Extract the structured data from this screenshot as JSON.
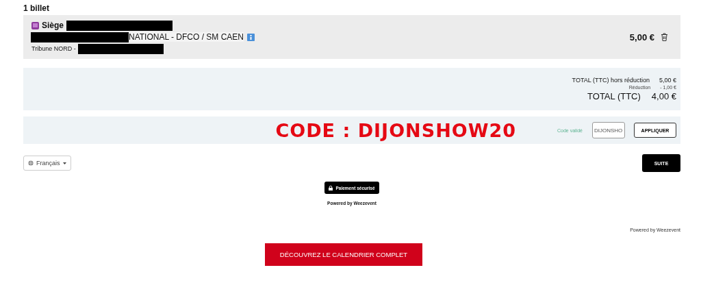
{
  "heading": "1 billet",
  "ticket": {
    "title": "Siège",
    "event": "NATIONAL - DFCO / SM CAEN",
    "area": "Tribune NORD -",
    "price": "5,00 €"
  },
  "summary": [
    {
      "label": "TOTAL (TTC) hors réduction",
      "value": "5,00 €",
      "kind": "normal"
    },
    {
      "label": "Réduction",
      "value": "- 1,00 €",
      "kind": "small"
    },
    {
      "label": "TOTAL (TTC)",
      "value": "4,00 €",
      "kind": "total"
    }
  ],
  "promo": {
    "banner": "CODE : DIJONSHOW20",
    "status": "Code validé",
    "value": "DIJONSHO",
    "button": "APPLIQUER"
  },
  "language": "Français",
  "next": "SUITE",
  "secure": "Paiement sécurisé",
  "powered": "Powered by Weezevent",
  "powered_footer": "Powered by Weezevent",
  "calendar": "DÉCOUVREZ LE CALENDRIER COMPLET"
}
